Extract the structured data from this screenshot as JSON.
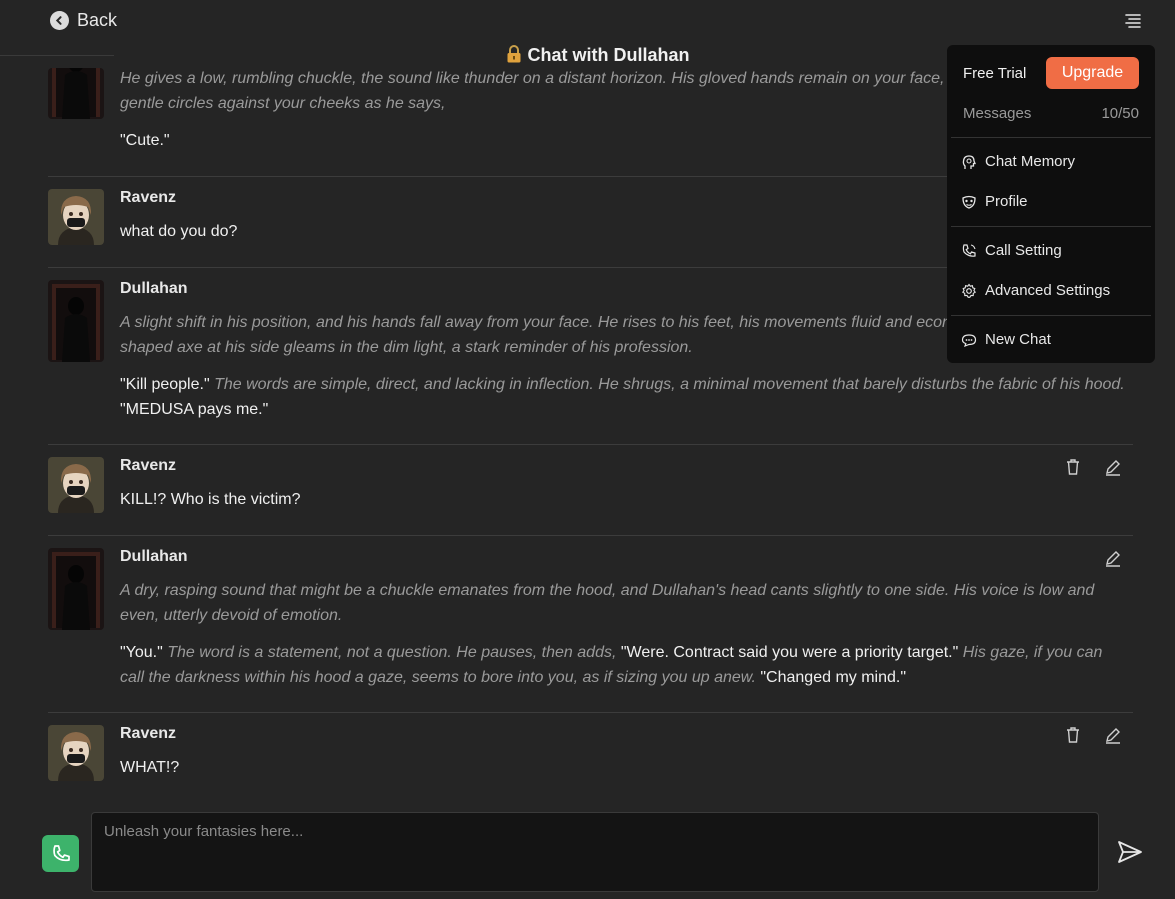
{
  "header": {
    "back_label": "Back",
    "title": "Chat with Dullahan",
    "lock_icon": "lock-icon",
    "menu_icon": "hamburger-menu-icon"
  },
  "messages": [
    {
      "sender": "",
      "role": "character",
      "paragraphs": [
        [
          {
            "style": "narration",
            "text": "He gives a low, rumbling chuckle, the sound like thunder on a distant horizon. His gloved hands remain on your face, his thumbs tracing gentle circles against your cheeks as he says,"
          }
        ],
        [
          {
            "style": "speech",
            "text": "\"Cute.\""
          }
        ]
      ]
    },
    {
      "sender": "Ravenz",
      "role": "user",
      "paragraphs": [
        [
          {
            "style": "speech",
            "text": "what do you do?"
          }
        ]
      ]
    },
    {
      "sender": "Dullahan",
      "role": "character",
      "paragraphs": [
        [
          {
            "style": "narration",
            "text": "A slight shift in his position, and his hands fall away from your face. He rises to his feet, his movements fluid and economical. The hook-shaped axe at his side gleams in the dim light, a stark reminder of his profession."
          }
        ],
        [
          {
            "style": "speech",
            "text": "\"Kill people.\" "
          },
          {
            "style": "narration",
            "text": "The words are simple, direct, and lacking in inflection. He shrugs, a minimal movement that barely disturbs the fabric of his hood. "
          },
          {
            "style": "speech",
            "text": "\"MEDUSA pays me.\""
          }
        ]
      ]
    },
    {
      "sender": "Ravenz",
      "role": "user",
      "paragraphs": [
        [
          {
            "style": "speech",
            "text": "KILL!? Who is the victim?"
          }
        ]
      ]
    },
    {
      "sender": "Dullahan",
      "role": "character",
      "paragraphs": [
        [
          {
            "style": "narration",
            "text": "A dry, rasping sound that might be a chuckle emanates from the hood, and Dullahan's head cants slightly to one side. His voice is low and even, utterly devoid of emotion."
          }
        ],
        [
          {
            "style": "speech",
            "text": "\"You.\" "
          },
          {
            "style": "narration",
            "text": "The word is a statement, not a question. He pauses, then adds, "
          },
          {
            "style": "speech",
            "text": "\"Were. Contract said you were a priority target.\" "
          },
          {
            "style": "narration",
            "text": "His gaze, if you can call the darkness within his hood a gaze, seems to bore into you, as if sizing you up anew. "
          },
          {
            "style": "speech",
            "text": "\"Changed my mind.\""
          }
        ]
      ]
    },
    {
      "sender": "Ravenz",
      "role": "user",
      "paragraphs": [
        [
          {
            "style": "speech",
            "text": "WHAT!?"
          }
        ]
      ]
    }
  ],
  "dropdown": {
    "plan_label": "Free Trial",
    "upgrade_label": "Upgrade",
    "messages_label": "Messages",
    "messages_count": "10/50",
    "items": [
      {
        "label": "Chat Memory",
        "icon": "brain-head-icon"
      },
      {
        "label": "Profile",
        "icon": "mask-icon"
      },
      {
        "label": "Call Setting",
        "icon": "phone-settings-icon"
      },
      {
        "label": "Advanced Settings",
        "icon": "gear-icon"
      },
      {
        "label": "New Chat",
        "icon": "chat-bubble-icon"
      }
    ]
  },
  "composer": {
    "placeholder": "Unleash your fantasies here...",
    "value": ""
  },
  "colors": {
    "background": "#252525",
    "upgrade_button": "#f06d45",
    "call_button": "#3db36b",
    "dropdown_bg": "#0e0e0e"
  }
}
